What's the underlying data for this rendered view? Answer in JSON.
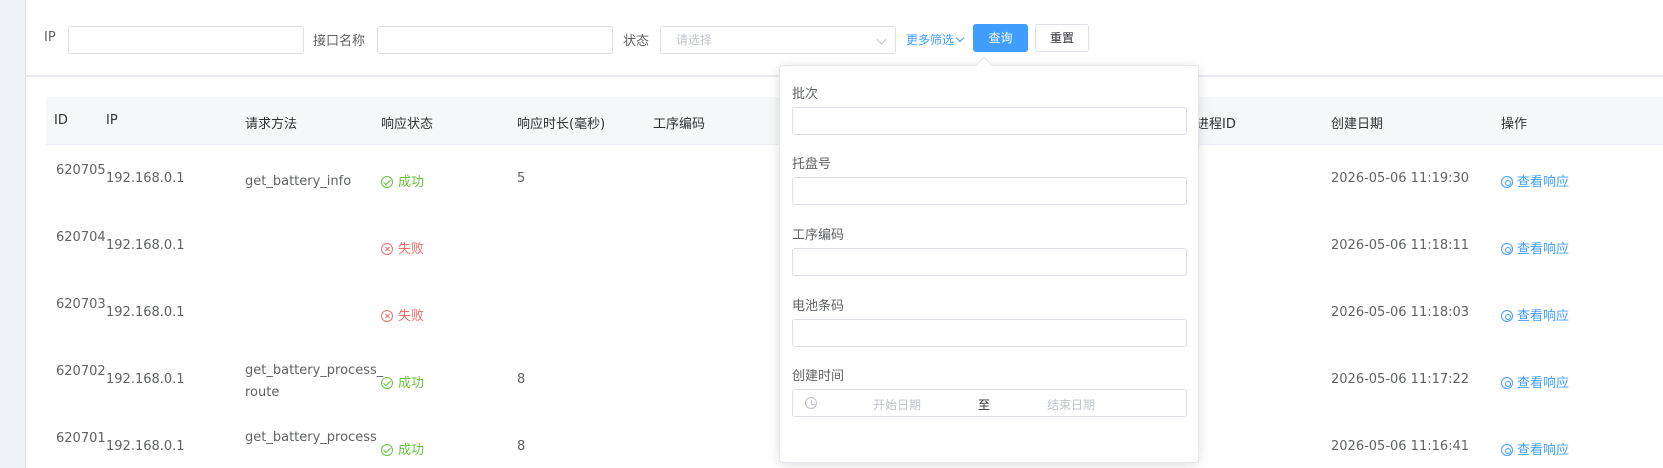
{
  "filters": {
    "ip_label": "IP",
    "api_name_label": "接口名称",
    "status_label": "状态",
    "status_placeholder": "请选择",
    "more_filters": "更多筛选",
    "query_button": "查询",
    "reset_button": "重置"
  },
  "table": {
    "headers": {
      "id": "ID",
      "ip": "IP",
      "method": "请求方法",
      "status": "响应状态",
      "duration": "响应时长(毫秒)",
      "process_code": "工序编码",
      "process_id": "进程ID",
      "created": "创建日期",
      "action": "操作"
    },
    "rows": [
      {
        "id": "620705",
        "ip": "192.168.0.1",
        "method": "get_battery_info",
        "status": "成功",
        "status_type": "success",
        "duration": "5",
        "created": "2026-05-06 11:19:30",
        "action": "查看响应"
      },
      {
        "id": "620704",
        "ip": "192.168.0.1",
        "method": "",
        "status": "失败",
        "status_type": "error",
        "duration": "",
        "created": "2026-05-06 11:18:11",
        "action": "查看响应"
      },
      {
        "id": "620703",
        "ip": "192.168.0.1",
        "method": "",
        "status": "失败",
        "status_type": "error",
        "duration": "",
        "created": "2026-05-06 11:18:03",
        "action": "查看响应"
      },
      {
        "id": "620702",
        "ip": "192.168.0.1",
        "method": "get_battery_process_route",
        "status": "成功",
        "status_type": "success",
        "duration": "8",
        "created": "2026-05-06 11:17:22",
        "action": "查看响应"
      },
      {
        "id": "620701",
        "ip": "192.168.0.1",
        "method": "get_battery_process",
        "status": "成功",
        "status_type": "success",
        "duration": "8",
        "created": "2026-05-06 11:16:41",
        "action": "查看响应"
      }
    ]
  },
  "popover": {
    "batch_label": "批次",
    "tray_label": "托盘号",
    "process_code_label": "工序编码",
    "battery_code_label": "电池条码",
    "created_time_label": "创建时间",
    "start_date_placeholder": "开始日期",
    "range_separator": "至",
    "end_date_placeholder": "结束日期"
  },
  "colors": {
    "primary": "#409eff",
    "success": "#67c23a",
    "error": "#f56c6c"
  }
}
